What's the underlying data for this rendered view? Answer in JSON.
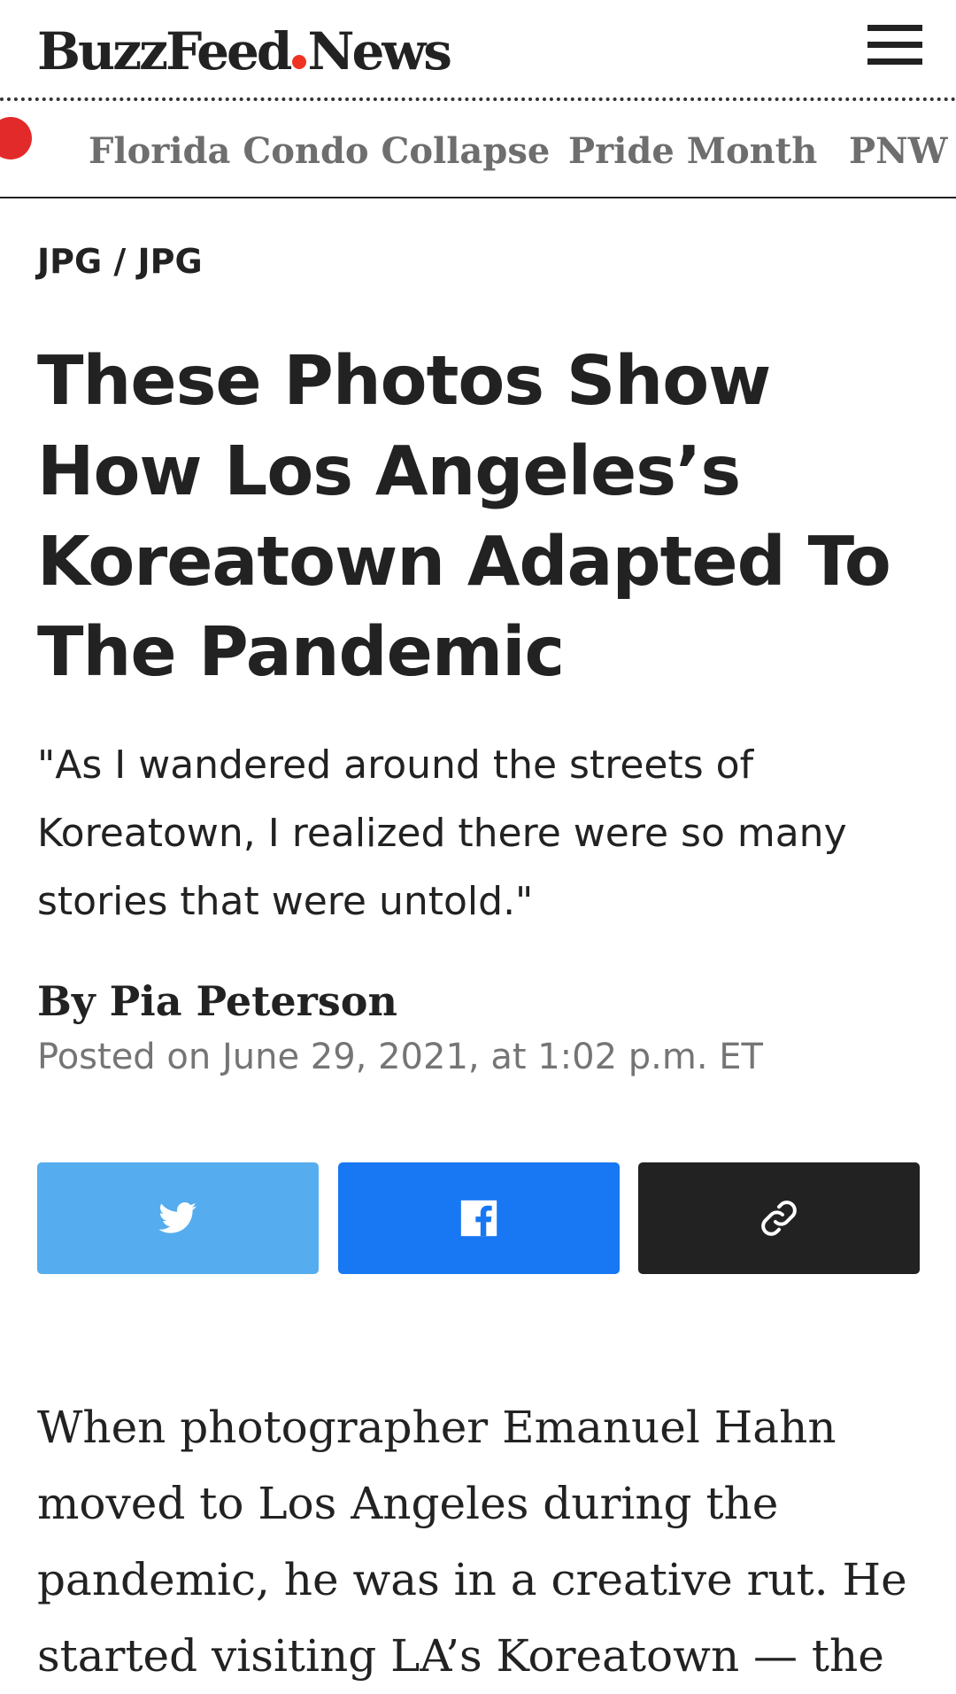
{
  "header": {
    "logo_part1": "BuzzFeed",
    "logo_part2": "News",
    "menu_icon": "hamburger-menu-icon"
  },
  "trending": {
    "live_indicator_icon": "red-dot-icon",
    "items": [
      {
        "label": "Florida Condo Collapse"
      },
      {
        "label": "Pride Month"
      },
      {
        "label": "PNW Heatwave"
      }
    ]
  },
  "article": {
    "section": "JPG / JPG",
    "headline": "These Photos Show How Los Angeles’s Koreatown Adapted To The Pandemic",
    "dek": "\"As I wandered around the streets of Koreatown, I realized there were so many stories that were untold.\"",
    "byline_prefix": "By",
    "author": "Pia Peterson",
    "posted": "Posted on June 29, 2021, at 1:02 p.m. ET",
    "body": "When photographer Emanuel Hahn moved to Los Angeles during the pandemic, he was in a creative rut. He started visiting LA’s Koreatown — the"
  },
  "share": {
    "buttons": [
      {
        "name": "twitter",
        "icon": "twitter-icon",
        "color": "#55acee"
      },
      {
        "name": "facebook",
        "icon": "facebook-icon",
        "color": "#1877f2"
      },
      {
        "name": "copy-link",
        "icon": "link-icon",
        "color": "#222222"
      }
    ]
  },
  "colors": {
    "brand_red": "#e32a2a",
    "text": "#222222",
    "muted": "#757575",
    "trend_text": "#6e6e6e"
  }
}
